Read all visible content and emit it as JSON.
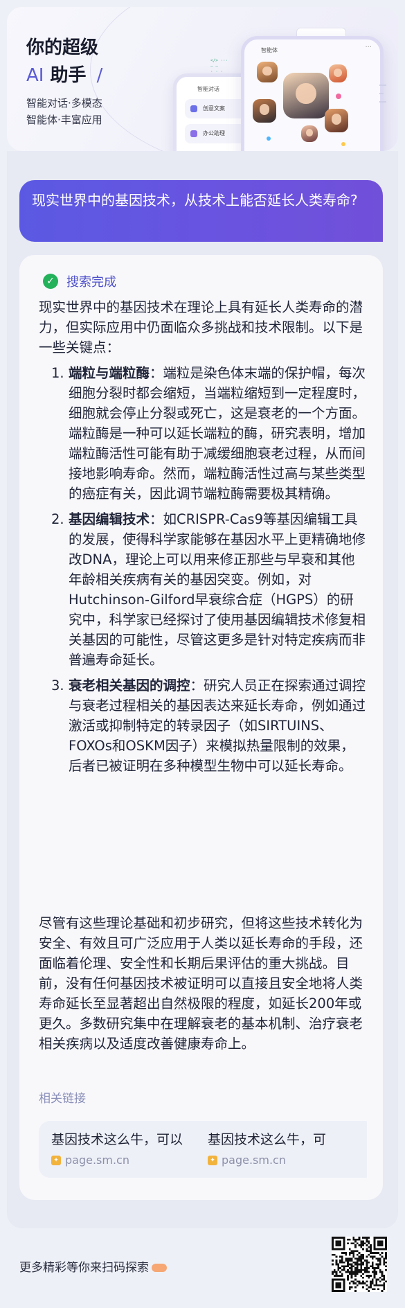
{
  "banner": {
    "title_line1": "你的超级",
    "title_ai": "AI",
    "title_assistant": "助手",
    "title_slash": "/",
    "sub_line1": "智能对话·多模态",
    "sub_line2": "智能体·丰富应用",
    "mock_back_title": "智能对话",
    "mock_back_items": [
      "创意文案",
      "办公助理"
    ],
    "mock_front_title": "智能体"
  },
  "question": "现实世界中的基因技术，从技术上能否延长人类寿命?",
  "answer": {
    "status": "搜索完成",
    "intro": "现实世界中的基因技术在理论上具有延长人类寿命的潜力，但实际应用中仍面临众多挑战和技术限制。以下是一些关键点：",
    "points": [
      {
        "number": "1.",
        "keyword": "端粒与端粒酶",
        "text": "：端粒是染色体末端的保护帽，每次细胞分裂时都会缩短，当端粒缩短到一定程度时，细胞就会停止分裂或死亡，这是衰老的一个方面。端粒酶是一种可以延长端粒的酶，研究表明，增加端粒酶活性可能有助于减缓细胞衰老过程，从而间接地影响寿命。然而，端粒酶活性过高与某些类型的癌症有关，因此调节端粒酶需要极其精确。"
      },
      {
        "number": "2.",
        "keyword": "基因编辑技术",
        "text": "：如CRISPR-Cas9等基因编辑工具的发展，使得科学家能够在基因水平上更精确地修改DNA，理论上可以用来修正那些与早衰和其他年龄相关疾病有关的基因突变。例如，对Hutchinson-Gilford早衰综合症（HGPS）的研究中，科学家已经探讨了使用基因编辑技术修复相关基因的可能性，尽管这更多是针对特定疾病而非普遍寿命延长。"
      },
      {
        "number": "3.",
        "keyword": "衰老相关基因的调控",
        "text": "：研究人员正在探索通过调控与衰老过程相关的基因表达来延长寿命，例如通过激活或抑制特定的转录因子（如SIRTUINS、FOXOs和OSKM因子）来模拟热量限制的效果，后者已被证明在多种模型生物中可以延长寿命。"
      }
    ],
    "outro": "尽管有这些理论基础和初步研究，但将这些技术转化为安全、有效且可广泛应用于人类以延长寿命的手段，还面临着伦理、安全性和长期后果评估的重大挑战。目前，没有任何基因技术被证明可以直接且安全地将人类寿命延长至显著超出自然极限的程度，如延长200年或更久。多数研究集中在理解衰老的基本机制、治疗衰老相关疾病以及适度改善健康寿命上。",
    "related_label": "相关链接",
    "links": [
      {
        "title": "基因技术这么牛，可以",
        "source": "page.sm.cn"
      },
      {
        "title": "基因技术这么牛，可",
        "source": "page.sm.cn"
      }
    ]
  },
  "footer": {
    "text": "更多精彩等你来扫码探索"
  },
  "colors": {
    "accent": "#5b59e3",
    "status_check": "#23b25a",
    "page_bg": "#eef0f7"
  }
}
